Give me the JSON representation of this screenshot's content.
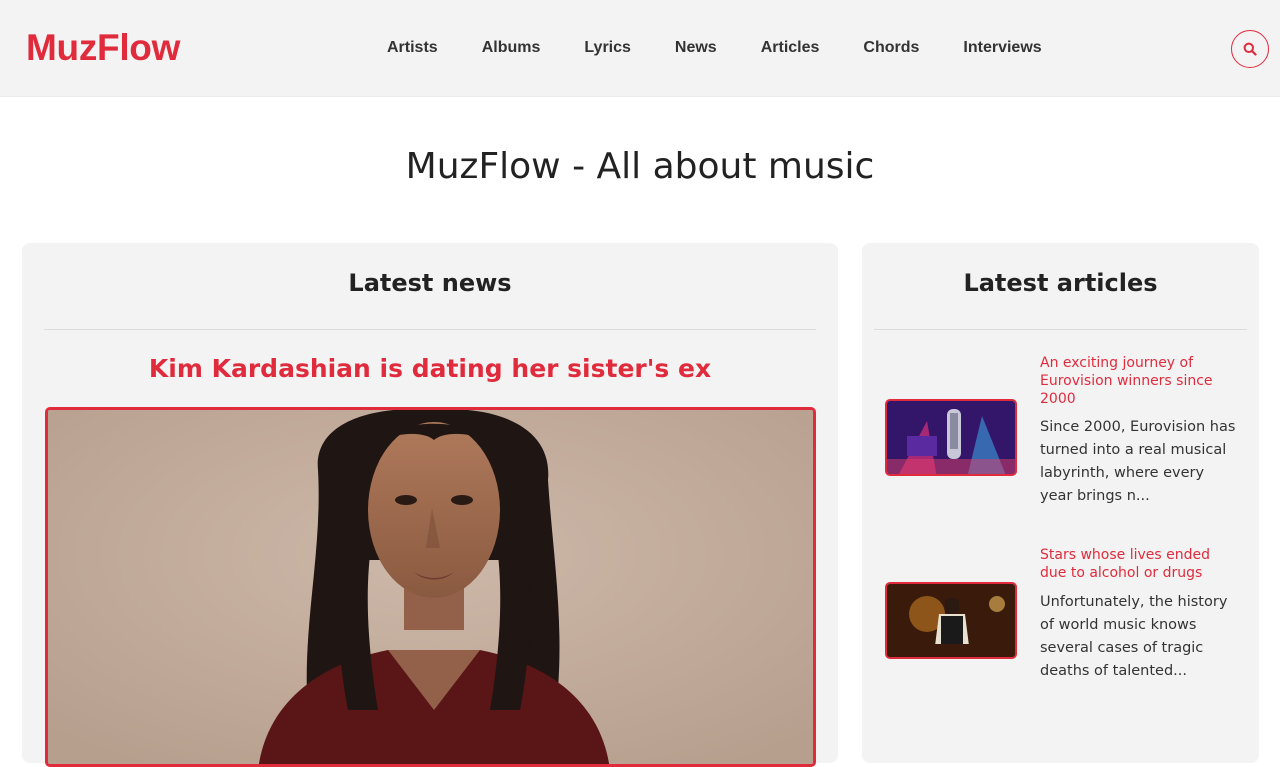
{
  "header": {
    "logo": "MuzFlow",
    "nav": [
      "Artists",
      "Albums",
      "Lyrics",
      "News",
      "Articles",
      "Chords",
      "Interviews"
    ],
    "search_icon": "search-icon"
  },
  "page": {
    "title": "MuzFlow - All about music"
  },
  "news": {
    "heading": "Latest news",
    "featured_title": "Kim Kardashian is dating her sister's ex"
  },
  "articles": {
    "heading": "Latest articles",
    "items": [
      {
        "title": "An exciting journey of Eurovision winners since 2000",
        "excerpt": "Since 2000, Eurovision has turned into a real musical labyrinth, where every year brings n..."
      },
      {
        "title": "Stars whose lives ended due to alcohol or drugs",
        "excerpt": "Unfortunately, the history of world music knows several cases of tragic deaths of talented..."
      }
    ]
  },
  "colors": {
    "accent": "#e02b3d",
    "header_bg": "#f3f3f3",
    "card_bg": "#f3f3f3"
  }
}
